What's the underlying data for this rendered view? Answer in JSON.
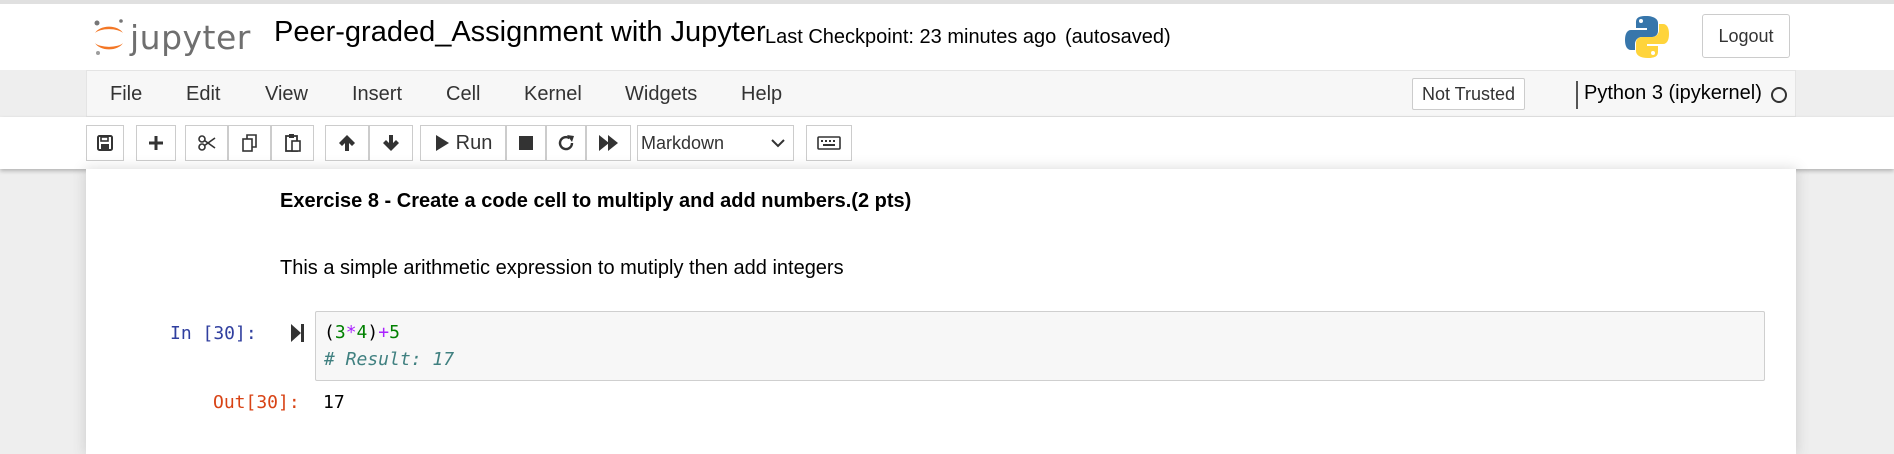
{
  "header": {
    "logo_text": "jupyter",
    "notebook_title": "Peer-graded_Assignment with Jupyter",
    "checkpoint": "Last Checkpoint: 23 minutes ago",
    "autosave_status": "(autosaved)",
    "logout_label": "Logout"
  },
  "menubar": {
    "items": [
      "File",
      "Edit",
      "View",
      "Insert",
      "Cell",
      "Kernel",
      "Widgets",
      "Help"
    ],
    "trust_label": "Not Trusted",
    "kernel_name": "Python 3 (ipykernel)"
  },
  "toolbar": {
    "run_label": "Run",
    "cell_type_selected": "Markdown",
    "icons": [
      "save-icon",
      "plus-icon",
      "scissors-icon",
      "copy-icon",
      "paste-icon",
      "arrow-up-icon",
      "arrow-down-icon",
      "play-icon",
      "stop-icon",
      "restart-icon",
      "fast-forward-icon",
      "keyboard-icon"
    ]
  },
  "notebook": {
    "markdown_heading": "Exercise 8 - Create a code cell to multiply and add numbers.(2 pts)",
    "markdown_text": "This a simple arithmetic expression to mutiply then add integers",
    "code_cell": {
      "in_prompt": "In [30]:",
      "code": {
        "open_paren": "(",
        "num_a": "3",
        "op_mul": "*",
        "num_b": "4",
        "close_paren": ")",
        "op_add": "+",
        "num_c": "5"
      },
      "comment": "# Result: 17",
      "out_prompt": "Out[30]:",
      "output": "17"
    }
  },
  "colors": {
    "in_prompt": "#303f9f",
    "out_prompt": "#d84315",
    "code_number": "#008000",
    "code_operator": "#aa22ff",
    "code_comment": "#408080",
    "logo_orange": "#f37726"
  }
}
